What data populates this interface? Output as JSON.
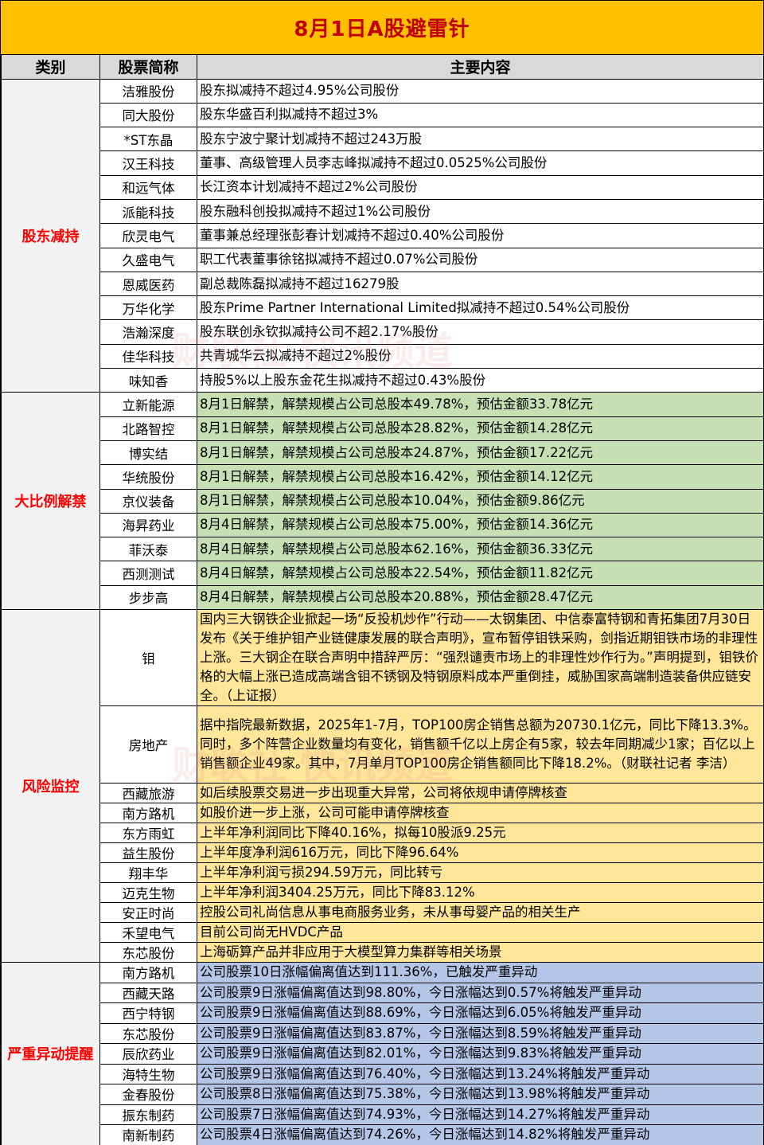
{
  "title": "8月1日A股避雷针",
  "header": {
    "category": "类别",
    "stock": "股票简称",
    "content": "主要内容"
  },
  "watermark": "财联社 快讯频道",
  "groups": [
    {
      "category": "股东减持",
      "rows": [
        {
          "name": "洁雅股份",
          "content": "股东拟减持不超过4.95%公司股份"
        },
        {
          "name": "同大股份",
          "content": "股东华盛百利拟减持不超过3%"
        },
        {
          "name": "*ST东晶",
          "content": "股东宁波宁聚计划减持不超过243万股"
        },
        {
          "name": "汉王科技",
          "content": "董事、高级管理人员李志峰拟减持不超过0.0525%公司股份"
        },
        {
          "name": "和远气体",
          "content": "长江资本计划减持不超过2%公司股份"
        },
        {
          "name": "派能科技",
          "content": "股东融科创投拟减持不超过1%公司股份"
        },
        {
          "name": "欣灵电气",
          "content": "董事兼总经理张彭春计划减持不超过0.40%公司股份"
        },
        {
          "name": "久盛电气",
          "content": "职工代表董事徐铭拟减持不超过0.07%公司股份"
        },
        {
          "name": "恩威医药",
          "content": "副总裁陈磊拟减持不超过16279股"
        },
        {
          "name": "万华化学",
          "content": "股东Prime Partner International Limited拟减持不超过0.54%公司股份"
        },
        {
          "name": "浩瀚深度",
          "content": "股东联创永钦拟减持公司不超2.17%股份"
        },
        {
          "name": "佳华科技",
          "content": "共青城华云拟减持不超过2%股份"
        },
        {
          "name": "味知香",
          "content": "持股5%以上股东金花生拟减持不超过0.43%股份"
        }
      ]
    },
    {
      "category": "大比例解禁",
      "rows": [
        {
          "name": "立新能源",
          "content": "8月1日解禁，解禁规模占公司总股本49.78%，预估金额33.78亿元"
        },
        {
          "name": "北路智控",
          "content": "8月1日解禁，解禁规模占公司总股本28.82%，预估金额14.28亿元"
        },
        {
          "name": "博实结",
          "content": "8月1日解禁，解禁规模占公司总股本24.87%，预估金额17.22亿元"
        },
        {
          "name": "华统股份",
          "content": "8月1日解禁，解禁规模占公司总股本16.42%，预估金额14.12亿元"
        },
        {
          "name": "京仪装备",
          "content": "8月1日解禁，解禁规模占公司总股本10.04%，预估金额9.86亿元"
        },
        {
          "name": "海昇药业",
          "content": "8月4日解禁，解禁规模占公司总股本75.00%，预估金额14.36亿元"
        },
        {
          "name": "菲沃泰",
          "content": "8月4日解禁，解禁规模占公司总股本62.16%，预估金额36.33亿元"
        },
        {
          "name": "西测测试",
          "content": "8月4日解禁，解禁规模占公司总股本22.54%，预估金额11.82亿元"
        },
        {
          "name": "步步高",
          "content": "8月4日解禁，解禁规模占公司总股本20.88%，预估金额28.47亿元"
        }
      ]
    },
    {
      "category": "风险监控",
      "rows": [
        {
          "name": "钼",
          "content": "国内三大钢铁企业掀起一场“反投机炒作”行动——太钢集团、中信泰富特钢和青拓集团7月30日发布《关于维护钼产业链健康发展的联合声明》，宣布暂停钼铁采购，剑指近期钼铁市场的非理性上涨。三大钢企在联合声明中措辞严厉：“强烈谴责市场上的非理性炒作行为。”声明提到，钼铁价格的大幅上涨已造成高端含钼不锈钢及特钢原料成本严重倒挂，威胁国家高端制造装备供应链安全。（上证报）"
        },
        {
          "name": "房地产",
          "content": "据中指院最新数据，2025年1-7月，TOP100房企销售总额为20730.1亿元，同比下降13.3%。同时，多个阵营企业数量均有变化，销售额千亿以上房企有5家，较去年同期减少1家；百亿以上销售额企业49家。其中，7月单月TOP100房企销售额同比下降18.2%。（财联社记者 李洁）"
        },
        {
          "name": "西藏旅游",
          "content": "如后续股票交易进一步出现重大异常，公司将依规申请停牌核查"
        },
        {
          "name": "南方路机",
          "content": "如股价进一步上涨，公司可能申请停牌核查"
        },
        {
          "name": "东方雨虹",
          "content": "上半年净利润同比下降40.16%，拟每10股派9.25元"
        },
        {
          "name": "益生股份",
          "content": "上半年度净利润616万元，同比下降96.64%"
        },
        {
          "name": "翔丰华",
          "content": "上半年净利润亏损294.59万元，同比转亏"
        },
        {
          "name": "迈克生物",
          "content": "上半年净利润3404.25万元，同比下降83.12%"
        },
        {
          "name": "安正时尚",
          "content": "控股公司礼尚信息从事电商服务业务，未从事母婴产品的相关生产"
        },
        {
          "name": "禾望电气",
          "content": "目前公司尚无HVDC产品"
        },
        {
          "name": "东芯股份",
          "content": "上海砺算产品并非应用于大模型算力集群等相关场景"
        }
      ]
    },
    {
      "category": "严重异动提醒",
      "rows": [
        {
          "name": "南方路机",
          "content": "公司股票10日涨幅偏离值达到111.36%，已触发严重异动"
        },
        {
          "name": "西藏天路",
          "content": "公司股票9日涨幅偏离值达到98.80%，今日涨幅达到0.57%将触发严重异动"
        },
        {
          "name": "西宁特钢",
          "content": "公司股票9日涨幅偏离值达到88.69%，今日涨幅达到6.05%将触发严重异动"
        },
        {
          "name": "东芯股份",
          "content": "公司股票9日涨幅偏离值达到83.87%，今日涨幅达到8.59%将触发严重异动"
        },
        {
          "name": "辰欣药业",
          "content": "公司股票9日涨幅偏离值达到82.01%，今日涨幅达到9.83%将触发严重异动"
        },
        {
          "name": "海特生物",
          "content": "公司股票9日涨幅偏离值达到76.40%，今日涨幅达到13.24%将触发严重异动"
        },
        {
          "name": "金春股份",
          "content": "公司股票8日涨幅偏离值达到75.38%，今日涨幅达到13.98%将触发严重异动"
        },
        {
          "name": "振东制药",
          "content": "公司股票7日涨幅偏离值达到74.93%，今日涨幅达到14.27%将触发严重异动"
        },
        {
          "name": "南新制药",
          "content": "公司股票4日涨幅偏离值达到74.26%，今日涨幅达到14.82%将触发严重异动"
        }
      ]
    }
  ]
}
